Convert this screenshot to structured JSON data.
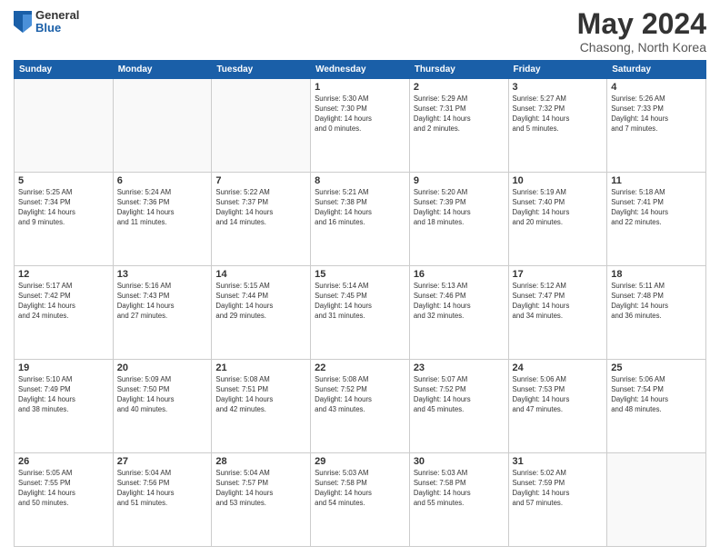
{
  "header": {
    "logo_general": "General",
    "logo_blue": "Blue",
    "title": "May 2024",
    "location": "Chasong, North Korea"
  },
  "days_of_week": [
    "Sunday",
    "Monday",
    "Tuesday",
    "Wednesday",
    "Thursday",
    "Friday",
    "Saturday"
  ],
  "weeks": [
    [
      {
        "day": "",
        "info": ""
      },
      {
        "day": "",
        "info": ""
      },
      {
        "day": "",
        "info": ""
      },
      {
        "day": "1",
        "info": "Sunrise: 5:30 AM\nSunset: 7:30 PM\nDaylight: 14 hours\nand 0 minutes."
      },
      {
        "day": "2",
        "info": "Sunrise: 5:29 AM\nSunset: 7:31 PM\nDaylight: 14 hours\nand 2 minutes."
      },
      {
        "day": "3",
        "info": "Sunrise: 5:27 AM\nSunset: 7:32 PM\nDaylight: 14 hours\nand 5 minutes."
      },
      {
        "day": "4",
        "info": "Sunrise: 5:26 AM\nSunset: 7:33 PM\nDaylight: 14 hours\nand 7 minutes."
      }
    ],
    [
      {
        "day": "5",
        "info": "Sunrise: 5:25 AM\nSunset: 7:34 PM\nDaylight: 14 hours\nand 9 minutes."
      },
      {
        "day": "6",
        "info": "Sunrise: 5:24 AM\nSunset: 7:36 PM\nDaylight: 14 hours\nand 11 minutes."
      },
      {
        "day": "7",
        "info": "Sunrise: 5:22 AM\nSunset: 7:37 PM\nDaylight: 14 hours\nand 14 minutes."
      },
      {
        "day": "8",
        "info": "Sunrise: 5:21 AM\nSunset: 7:38 PM\nDaylight: 14 hours\nand 16 minutes."
      },
      {
        "day": "9",
        "info": "Sunrise: 5:20 AM\nSunset: 7:39 PM\nDaylight: 14 hours\nand 18 minutes."
      },
      {
        "day": "10",
        "info": "Sunrise: 5:19 AM\nSunset: 7:40 PM\nDaylight: 14 hours\nand 20 minutes."
      },
      {
        "day": "11",
        "info": "Sunrise: 5:18 AM\nSunset: 7:41 PM\nDaylight: 14 hours\nand 22 minutes."
      }
    ],
    [
      {
        "day": "12",
        "info": "Sunrise: 5:17 AM\nSunset: 7:42 PM\nDaylight: 14 hours\nand 24 minutes."
      },
      {
        "day": "13",
        "info": "Sunrise: 5:16 AM\nSunset: 7:43 PM\nDaylight: 14 hours\nand 27 minutes."
      },
      {
        "day": "14",
        "info": "Sunrise: 5:15 AM\nSunset: 7:44 PM\nDaylight: 14 hours\nand 29 minutes."
      },
      {
        "day": "15",
        "info": "Sunrise: 5:14 AM\nSunset: 7:45 PM\nDaylight: 14 hours\nand 31 minutes."
      },
      {
        "day": "16",
        "info": "Sunrise: 5:13 AM\nSunset: 7:46 PM\nDaylight: 14 hours\nand 32 minutes."
      },
      {
        "day": "17",
        "info": "Sunrise: 5:12 AM\nSunset: 7:47 PM\nDaylight: 14 hours\nand 34 minutes."
      },
      {
        "day": "18",
        "info": "Sunrise: 5:11 AM\nSunset: 7:48 PM\nDaylight: 14 hours\nand 36 minutes."
      }
    ],
    [
      {
        "day": "19",
        "info": "Sunrise: 5:10 AM\nSunset: 7:49 PM\nDaylight: 14 hours\nand 38 minutes."
      },
      {
        "day": "20",
        "info": "Sunrise: 5:09 AM\nSunset: 7:50 PM\nDaylight: 14 hours\nand 40 minutes."
      },
      {
        "day": "21",
        "info": "Sunrise: 5:08 AM\nSunset: 7:51 PM\nDaylight: 14 hours\nand 42 minutes."
      },
      {
        "day": "22",
        "info": "Sunrise: 5:08 AM\nSunset: 7:52 PM\nDaylight: 14 hours\nand 43 minutes."
      },
      {
        "day": "23",
        "info": "Sunrise: 5:07 AM\nSunset: 7:52 PM\nDaylight: 14 hours\nand 45 minutes."
      },
      {
        "day": "24",
        "info": "Sunrise: 5:06 AM\nSunset: 7:53 PM\nDaylight: 14 hours\nand 47 minutes."
      },
      {
        "day": "25",
        "info": "Sunrise: 5:06 AM\nSunset: 7:54 PM\nDaylight: 14 hours\nand 48 minutes."
      }
    ],
    [
      {
        "day": "26",
        "info": "Sunrise: 5:05 AM\nSunset: 7:55 PM\nDaylight: 14 hours\nand 50 minutes."
      },
      {
        "day": "27",
        "info": "Sunrise: 5:04 AM\nSunset: 7:56 PM\nDaylight: 14 hours\nand 51 minutes."
      },
      {
        "day": "28",
        "info": "Sunrise: 5:04 AM\nSunset: 7:57 PM\nDaylight: 14 hours\nand 53 minutes."
      },
      {
        "day": "29",
        "info": "Sunrise: 5:03 AM\nSunset: 7:58 PM\nDaylight: 14 hours\nand 54 minutes."
      },
      {
        "day": "30",
        "info": "Sunrise: 5:03 AM\nSunset: 7:58 PM\nDaylight: 14 hours\nand 55 minutes."
      },
      {
        "day": "31",
        "info": "Sunrise: 5:02 AM\nSunset: 7:59 PM\nDaylight: 14 hours\nand 57 minutes."
      },
      {
        "day": "",
        "info": ""
      }
    ]
  ]
}
